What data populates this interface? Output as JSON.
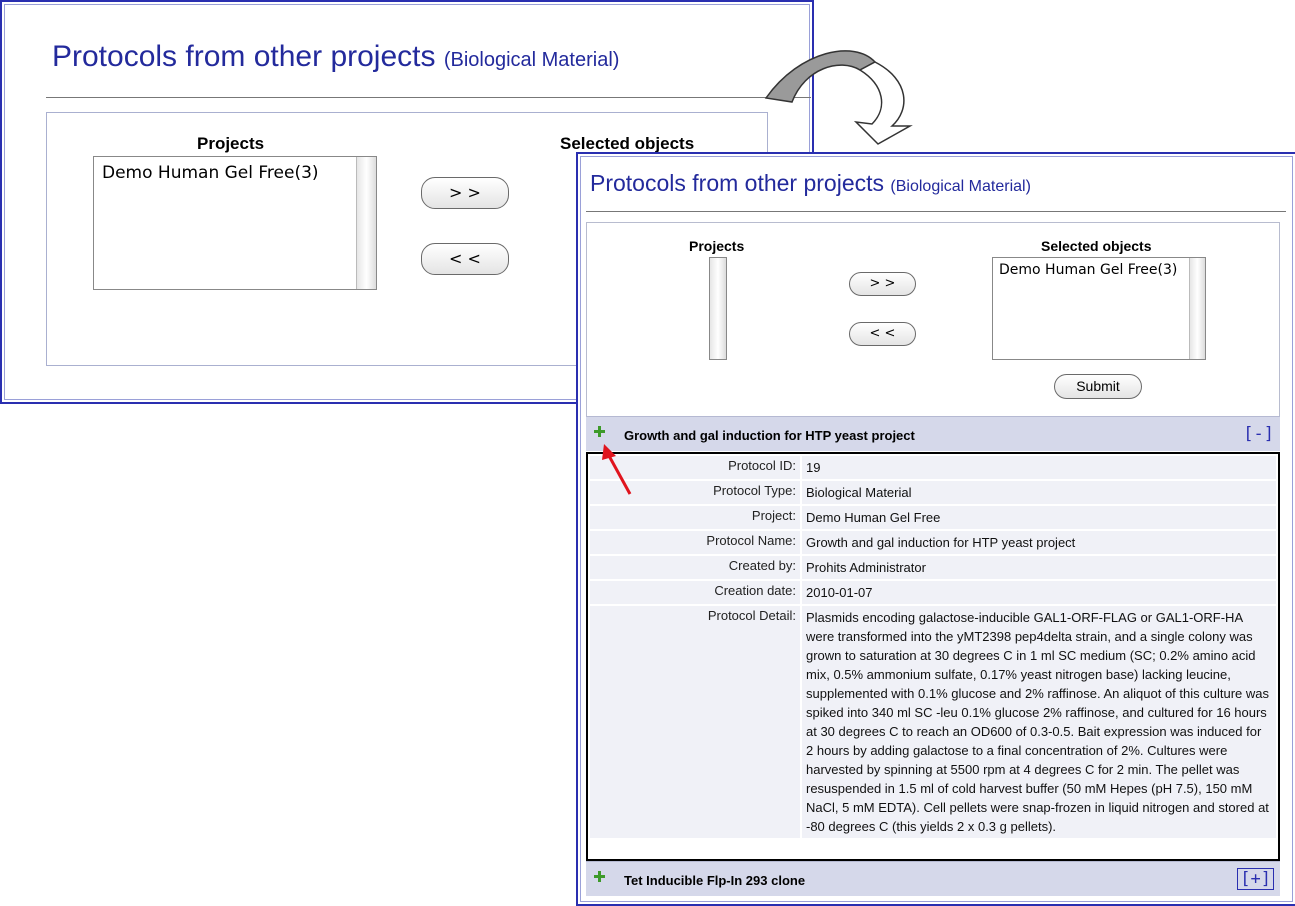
{
  "back_panel": {
    "title": "Protocols from other projects",
    "subtitle": "(Biological Material)",
    "projects_label": "Projects",
    "selected_label": "Selected objects",
    "projects_list": [
      "Demo Human Gel Free(3)"
    ],
    "add_button": "> >",
    "remove_button": "< <"
  },
  "front_panel": {
    "title": "Protocols from other projects",
    "subtitle": "(Biological Material)",
    "projects_label": "Projects",
    "selected_label": "Selected objects",
    "selected_list": [
      "Demo Human Gel Free(3)"
    ],
    "add_button": "> >",
    "remove_button": "< <",
    "submit_button": "Submit",
    "protocols": [
      {
        "title": "Growth and gal induction for HTP yeast project",
        "toggle": "[-]",
        "expanded": true,
        "details": [
          {
            "label": "Protocol ID:",
            "value": "19"
          },
          {
            "label": "Protocol Type:",
            "value": "Biological Material"
          },
          {
            "label": "Project:",
            "value": "Demo Human Gel Free"
          },
          {
            "label": "Protocol Name:",
            "value": "Growth and gal induction for HTP yeast project"
          },
          {
            "label": "Created by:",
            "value": "Prohits Administrator"
          },
          {
            "label": "Creation date:",
            "value": "2010-01-07"
          },
          {
            "label": "Protocol Detail:",
            "value": "Plasmids encoding galactose-inducible GAL1-ORF-FLAG or GAL1-ORF-HA were transformed into the yMT2398 pep4delta strain, and a single colony was grown to saturation at 30 degrees C in 1 ml SC medium (SC; 0.2% amino acid mix, 0.5% ammonium sulfate, 0.17% yeast nitrogen base) lacking leucine, supplemented with 0.1% glucose and 2% raffinose. An aliquot of this culture was spiked into 340 ml SC -leu 0.1% glucose 2% raffinose, and cultured for 16 hours at 30 degrees C to reach an OD600 of 0.3-0.5. Bait expression was induced for 2 hours by adding galactose to a final concentration of 2%. Cultures were harvested by spinning at 5500 rpm at 4 degrees C for 2 min. The pellet was resuspended in 1.5 ml of cold harvest buffer (50 mM Hepes (pH 7.5), 150 mM NaCl, 5 mM EDTA). Cell pellets were snap-frozen in liquid nitrogen and stored at -80 degrees C (this yields 2 x 0.3 g pellets)."
          }
        ]
      },
      {
        "title": "Tet Inducible Flp-In 293 clone",
        "toggle": "[+]",
        "expanded": false
      }
    ]
  },
  "colors": {
    "title_blue": "#232a9c",
    "panel_border": "#2a2fb0",
    "header_bg": "#d5d8ea",
    "plus_green": "#3d9a2a",
    "pointer_red": "#e0141e"
  },
  "icons": {
    "transition_arrow": "curved-arrow-icon",
    "expand": "plus-icon",
    "pointer": "red-arrow-icon"
  }
}
